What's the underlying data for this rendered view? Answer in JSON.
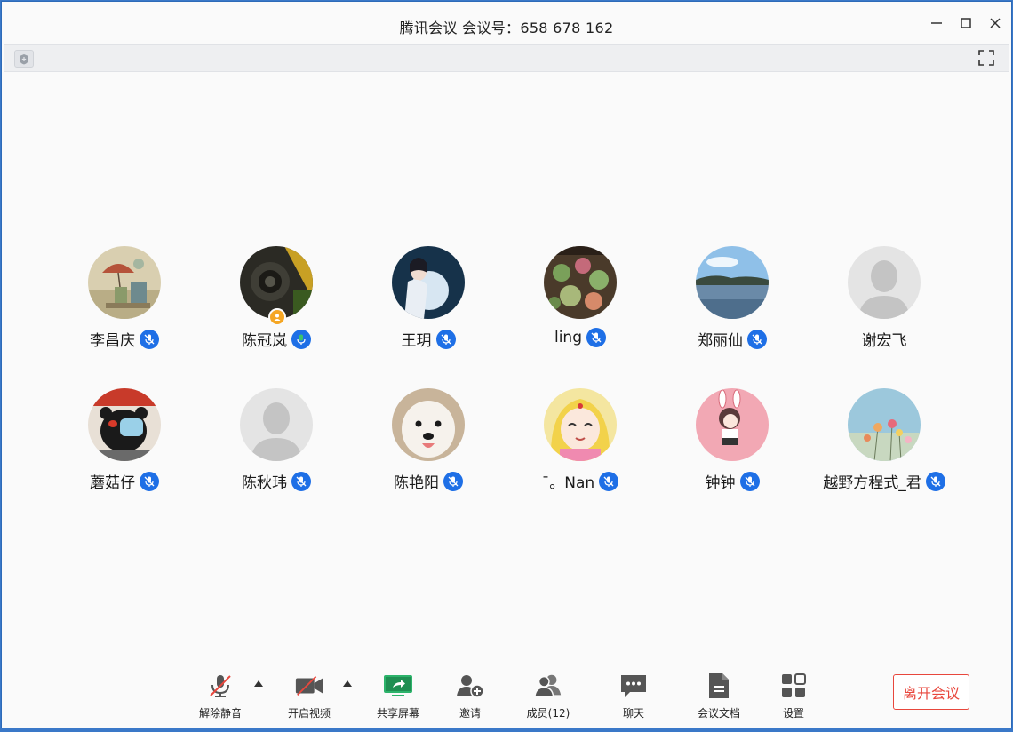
{
  "window": {
    "title": "腾讯会议 会议号：658 678 162"
  },
  "participants": [
    {
      "name": "李昌庆",
      "mic": "muted",
      "avatar": "umbrella-painting"
    },
    {
      "name": "陈冠岚",
      "mic": "on",
      "avatar": "dark-photo",
      "host": true
    },
    {
      "name": "王玥",
      "mic": "muted",
      "avatar": "girl-moon"
    },
    {
      "name": "ling",
      "mic": "muted",
      "avatar": "succulents"
    },
    {
      "name": "郑丽仙",
      "mic": "muted",
      "avatar": "lake"
    },
    {
      "name": "谢宏飞",
      "mic": "none",
      "avatar": "default"
    },
    {
      "name": "蘑菇仔",
      "mic": "muted",
      "avatar": "kumamon"
    },
    {
      "name": "陈秋玮",
      "mic": "muted",
      "avatar": "default"
    },
    {
      "name": "陈艳阳",
      "mic": "muted",
      "avatar": "dog"
    },
    {
      "name": "ˉ。Nan",
      "mic": "muted",
      "avatar": "sailor-moon"
    },
    {
      "name": "钟钟",
      "mic": "muted",
      "avatar": "bunny-girl"
    },
    {
      "name": "越野方程式_君",
      "mic": "muted",
      "avatar": "flowers"
    }
  ],
  "toolbar": {
    "unmute": "解除静音",
    "start_video": "开启视频",
    "share_screen": "共享屏幕",
    "invite": "邀请",
    "members": "成员(12)",
    "chat": "聊天",
    "docs": "会议文档",
    "settings": "设置",
    "leave": "离开会议"
  },
  "colors": {
    "mic_blue": "#1e6fe6",
    "leave_red": "#e8473d",
    "share_green": "#2db36b"
  }
}
